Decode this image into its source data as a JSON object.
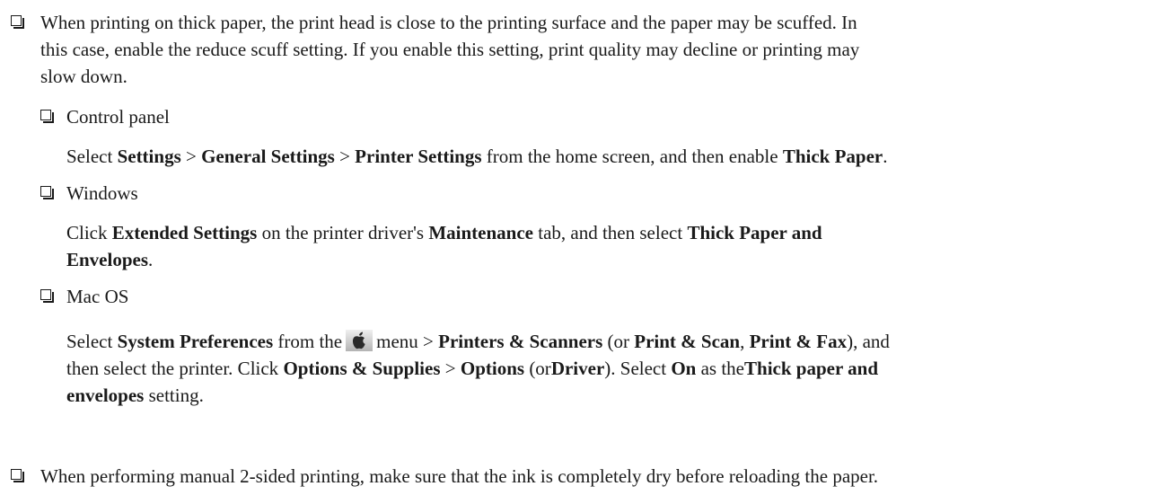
{
  "item1": {
    "line1": "When printing on thick paper, the print head is close to the printing surface and the paper may be scuffed. In",
    "line2": "this case, enable the reduce scuff setting. If you enable this setting, print quality may decline or printing may",
    "line3": "slow down.",
    "control_panel": {
      "heading": "Control panel",
      "select": "Select",
      "settings": "Settings",
      "sep": ">",
      "general_settings": "General Settings",
      "printer_settings": "Printer Settings",
      "from_home": "from the home screen, and then enable",
      "thick_paper": "Thick Paper",
      "period": "."
    },
    "windows": {
      "heading": "Windows",
      "click": "Click",
      "extended_settings": "Extended Settings",
      "on_driver": "on the printer driver's",
      "maintenance": "Maintenance",
      "tab_then": "tab, and then select",
      "thick_paper_and": "Thick Paper and",
      "envelopes": "Envelopes",
      "period": "."
    },
    "macos": {
      "heading": "Mac OS",
      "select": "Select",
      "system_preferences": "System Preferences",
      "from_the": "from the",
      "apple_icon": "apple-menu-icon",
      "menu": "menu",
      "sep": ">",
      "printers_scanners": "Printers & Scanners",
      "or_open": "(or",
      "print_scan": "Print & Scan",
      "comma": ",",
      "print_fax": "Print & Fax",
      "and_then": "), and",
      "line2_start": "then select the printer. Click",
      "options_supplies": "Options & Supplies",
      "options": "Options",
      "driver": "Driver",
      "close_paren_select": "). Select",
      "on": "On",
      "as_the": "as the",
      "thick_paper_and": "Thick paper and",
      "envelopes": "envelopes",
      "setting": "setting."
    }
  },
  "item2": {
    "line1": "When performing manual 2-sided printing, make sure that the ink is completely dry before reloading the paper."
  }
}
